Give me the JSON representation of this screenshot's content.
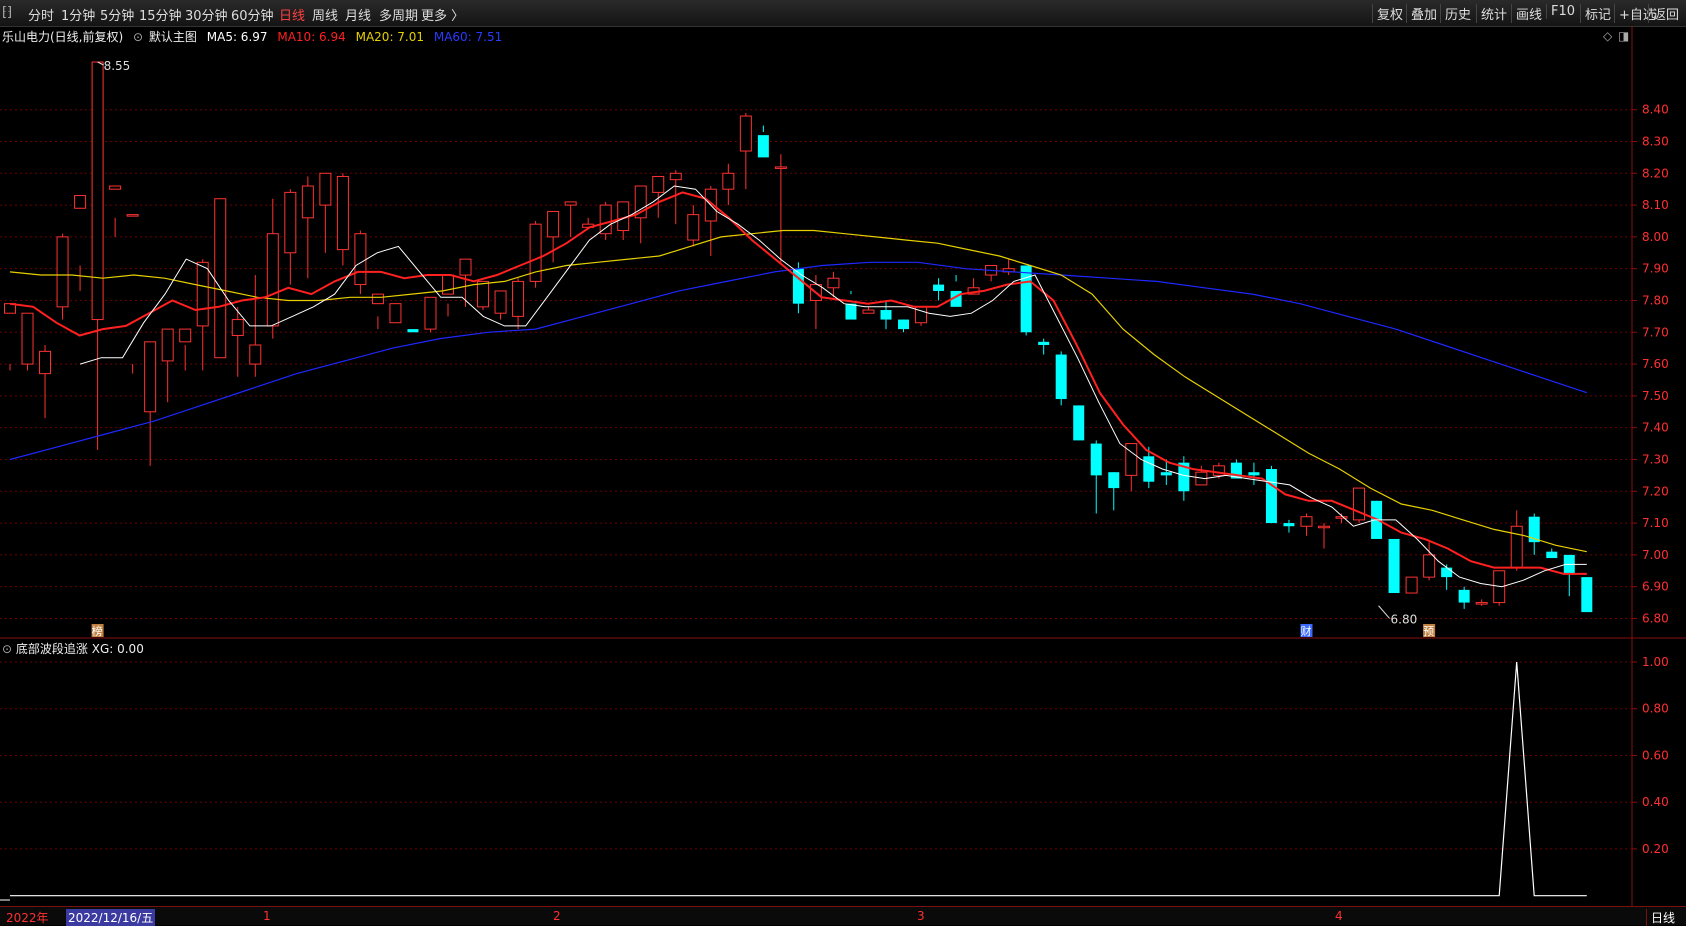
{
  "toolbar": {
    "left_icon": "⁅⁆",
    "periods": [
      "分时",
      "1分钟",
      "5分钟",
      "15分钟",
      "30分钟",
      "60分钟",
      "日线",
      "周线",
      "月线",
      "多周期",
      "更多 〉"
    ],
    "active_period": "日线",
    "right_buttons": [
      "复权",
      "叠加",
      "历史",
      "统计",
      "画线",
      "F10",
      "标记",
      "+自选",
      "返回"
    ]
  },
  "legend": {
    "stock": "乐山电力(日线,前复权)",
    "template": "默认主图",
    "ma5": "MA5: 6.97",
    "ma10": "MA10: 6.94",
    "ma20": "MA20: 7.01",
    "ma60": "MA60: 7.51"
  },
  "indicator_legend": {
    "name": "底部波段追涨",
    "value": "XG: 0.00"
  },
  "bottom": {
    "year": "2022年",
    "cursor_date": "2022/12/16/五",
    "month_labels": [
      "1",
      "2",
      "3",
      "4"
    ],
    "period_tab": "日线"
  },
  "colors": {
    "up": "#ff3232",
    "down": "#00ffff",
    "ma5": "#ffffff",
    "ma10": "#ff2020",
    "ma20": "#e6d000",
    "ma60": "#1e28ff",
    "grid": "#6a0000",
    "axis_text": "#ff3030"
  },
  "chart_data": [
    {
      "type": "candlestick",
      "title": "乐山电力(日线,前复权)",
      "y_ticks": [
        "8.40",
        "8.30",
        "8.20",
        "8.10",
        "8.00",
        "7.90",
        "7.80",
        "7.70",
        "7.60",
        "7.50",
        "7.40",
        "7.30",
        "7.20",
        "7.10",
        "7.00",
        "6.90",
        "6.80"
      ],
      "ylim": [
        6.77,
        8.55
      ],
      "annotations": {
        "high": "8.55",
        "low": "6.80"
      },
      "event_markers": [
        "榜",
        "财",
        "预"
      ],
      "ohlc": [
        [
          7.76,
          7.79,
          7.58,
          7.6
        ],
        [
          7.6,
          7.76,
          7.58,
          7.75
        ],
        [
          7.57,
          7.64,
          7.43,
          7.66
        ],
        [
          7.78,
          8.0,
          7.74,
          8.01
        ],
        [
          8.09,
          8.13,
          7.83,
          7.91
        ],
        [
          7.74,
          8.55,
          7.33,
          8.15
        ],
        [
          8.15,
          8.16,
          8.0,
          8.06
        ],
        [
          8.07,
          8.07,
          7.57,
          7.6
        ],
        [
          7.45,
          7.67,
          7.28,
          7.67
        ],
        [
          7.61,
          7.71,
          7.48,
          7.71
        ],
        [
          7.67,
          7.71,
          7.58,
          7.66
        ],
        [
          7.72,
          7.92,
          7.58,
          7.93
        ],
        [
          7.62,
          8.12,
          7.62,
          7.89
        ],
        [
          7.69,
          7.74,
          7.56,
          7.78
        ],
        [
          7.6,
          7.66,
          7.56,
          7.88
        ],
        [
          7.72,
          8.01,
          7.68,
          8.12
        ],
        [
          7.95,
          8.14,
          7.85,
          8.15
        ],
        [
          8.06,
          8.16,
          7.87,
          8.19
        ],
        [
          8.1,
          8.2,
          7.95,
          8.13
        ],
        [
          7.96,
          8.19,
          7.91,
          8.2
        ],
        [
          7.85,
          8.01,
          7.82,
          8.02
        ],
        [
          7.79,
          7.82,
          7.71,
          7.75
        ],
        [
          7.73,
          7.79,
          7.73,
          7.73
        ],
        [
          7.71,
          7.7,
          7.65,
          7.65
        ],
        [
          7.71,
          7.81,
          7.7,
          7.8
        ],
        [
          7.82,
          7.88,
          7.75,
          7.79
        ],
        [
          7.88,
          7.93,
          7.78,
          7.89
        ],
        [
          7.78,
          7.86,
          7.77,
          7.86
        ],
        [
          7.76,
          7.83,
          7.74,
          7.8
        ],
        [
          7.75,
          7.86,
          7.71,
          7.87
        ],
        [
          7.86,
          8.04,
          7.84,
          8.05
        ],
        [
          8.0,
          8.08,
          7.92,
          8.08
        ],
        [
          8.1,
          8.11,
          8.0,
          8.1
        ],
        [
          8.03,
          8.04,
          8.03,
          8.06
        ],
        [
          8.01,
          8.1,
          7.99,
          8.11
        ],
        [
          8.02,
          8.11,
          7.99,
          8.05
        ],
        [
          8.06,
          8.16,
          7.98,
          8.15
        ],
        [
          8.14,
          8.19,
          8.06,
          8.15
        ],
        [
          8.18,
          8.2,
          8.04,
          8.21
        ],
        [
          7.99,
          8.07,
          7.97,
          8.1
        ],
        [
          8.05,
          8.15,
          7.94,
          8.16
        ],
        [
          8.15,
          8.2,
          8.1,
          8.23
        ],
        [
          8.27,
          8.38,
          8.15,
          8.39
        ],
        [
          8.32,
          8.25,
          8.33,
          8.35
        ],
        [
          8.22,
          8.22,
          7.92,
          8.26
        ],
        [
          7.9,
          7.79,
          7.76,
          7.92
        ],
        [
          7.8,
          7.85,
          7.71,
          7.88
        ],
        [
          7.84,
          7.87,
          7.81,
          7.89
        ],
        [
          7.79,
          7.74,
          7.83,
          7.82
        ],
        [
          7.76,
          7.77,
          7.76,
          7.78
        ],
        [
          7.77,
          7.74,
          7.71,
          7.8
        ],
        [
          7.74,
          7.71,
          7.7,
          7.74
        ],
        [
          7.73,
          7.78,
          7.72,
          7.78
        ],
        [
          7.85,
          7.83,
          7.8,
          7.87
        ],
        [
          7.83,
          7.78,
          7.86,
          7.88
        ],
        [
          7.82,
          7.84,
          7.83,
          7.87
        ],
        [
          7.88,
          7.91,
          7.86,
          7.88
        ],
        [
          7.89,
          7.9,
          7.93,
          7.88
        ],
        [
          7.91,
          7.7,
          7.69,
          7.91
        ],
        [
          7.67,
          7.66,
          7.63,
          7.68
        ],
        [
          7.63,
          7.49,
          7.47,
          7.64
        ],
        [
          7.47,
          7.36,
          7.37,
          7.47
        ],
        [
          7.35,
          7.25,
          7.13,
          7.36
        ],
        [
          7.26,
          7.21,
          7.14,
          7.26
        ],
        [
          7.25,
          7.35,
          7.2,
          7.35
        ],
        [
          7.31,
          7.23,
          7.21,
          7.34
        ],
        [
          7.26,
          7.25,
          7.22,
          7.3
        ],
        [
          7.29,
          7.2,
          7.17,
          7.31
        ],
        [
          7.22,
          7.26,
          7.24,
          7.28
        ],
        [
          7.25,
          7.28,
          7.24,
          7.29
        ],
        [
          7.29,
          7.24,
          7.25,
          7.3
        ],
        [
          7.26,
          7.25,
          7.22,
          7.29
        ],
        [
          7.27,
          7.1,
          7.1,
          7.28
        ],
        [
          7.1,
          7.09,
          7.07,
          7.11
        ],
        [
          7.09,
          7.12,
          7.06,
          7.13
        ],
        [
          7.09,
          7.09,
          7.02,
          7.1
        ],
        [
          7.12,
          7.12,
          7.1,
          7.13
        ],
        [
          7.11,
          7.21,
          7.1,
          7.21
        ],
        [
          7.17,
          7.05,
          7.05,
          7.17
        ],
        [
          7.05,
          6.88,
          6.88,
          7.05
        ],
        [
          6.88,
          6.93,
          6.9,
          6.93
        ],
        [
          6.93,
          7.0,
          6.92,
          7.04
        ],
        [
          6.96,
          6.93,
          6.89,
          6.97
        ],
        [
          6.89,
          6.85,
          6.83,
          6.9
        ],
        [
          6.85,
          6.85,
          6.84,
          6.86
        ],
        [
          6.85,
          6.95,
          6.84,
          6.95
        ],
        [
          6.96,
          7.09,
          6.95,
          7.14
        ],
        [
          7.12,
          7.04,
          7.0,
          7.13
        ],
        [
          7.01,
          6.99,
          7.0,
          7.02
        ],
        [
          7.0,
          6.94,
          6.87,
          7.0
        ],
        [
          6.93,
          6.82,
          6.82,
          6.93
        ]
      ],
      "ma5": [
        7.6,
        7.62,
        7.62,
        7.73,
        7.82,
        7.93,
        7.9,
        7.8,
        7.72,
        7.72,
        7.75,
        7.78,
        7.82,
        7.91,
        7.95,
        7.97,
        7.89,
        7.81,
        7.81,
        7.75,
        7.72,
        7.72,
        7.81,
        7.9,
        7.99,
        8.04,
        8.07,
        8.11,
        8.16,
        8.15,
        8.08,
        8.04,
        7.99,
        7.93,
        7.88,
        7.84,
        7.79,
        7.78,
        7.78,
        7.78,
        7.76,
        7.75,
        7.76,
        7.8,
        7.86,
        7.88,
        7.75,
        7.62,
        7.48,
        7.35,
        7.3,
        7.27,
        7.25,
        7.24,
        7.25,
        7.24,
        7.23,
        7.22,
        7.18,
        7.15,
        7.09,
        7.11,
        7.11,
        7.05,
        6.98,
        6.93,
        6.91,
        6.9,
        6.92,
        6.95,
        6.97,
        6.97
      ],
      "ma5_start": 4,
      "ma10": [
        7.79,
        7.78,
        7.73,
        7.69,
        7.71,
        7.72,
        7.76,
        7.8,
        7.77,
        7.78,
        7.8,
        7.81,
        7.84,
        7.82,
        7.86,
        7.89,
        7.89,
        7.87,
        7.88,
        7.88,
        7.86,
        7.88,
        7.91,
        7.94,
        7.98,
        8.03,
        8.05,
        8.07,
        8.11,
        8.14,
        8.12,
        8.06,
        7.99,
        7.93,
        7.87,
        7.81,
        7.8,
        7.79,
        7.8,
        7.78,
        7.78,
        7.82,
        7.83,
        7.85,
        7.86,
        7.8,
        7.66,
        7.51,
        7.41,
        7.33,
        7.29,
        7.27,
        7.26,
        7.25,
        7.24,
        7.19,
        7.17,
        7.17,
        7.14,
        7.11,
        7.07,
        7.05,
        7.02,
        6.98,
        6.96,
        6.96,
        6.96,
        6.94,
        6.94
      ],
      "ma10_start": 0,
      "ma20": [
        7.89,
        7.88,
        7.88,
        7.87,
        7.88,
        7.87,
        7.85,
        7.83,
        7.81,
        7.8,
        7.8,
        7.81,
        7.81,
        7.82,
        7.83,
        7.85,
        7.86,
        7.89,
        7.91,
        7.92,
        7.93,
        7.94,
        7.97,
        8.0,
        8.01,
        8.02,
        8.02,
        8.01,
        8.0,
        7.99,
        7.98,
        7.96,
        7.94,
        7.91,
        7.88,
        7.82,
        7.71,
        7.63,
        7.56,
        7.5,
        7.44,
        7.38,
        7.32,
        7.27,
        7.21,
        7.16,
        7.14,
        7.11,
        7.08,
        7.06,
        7.03,
        7.01
      ],
      "ma20_start": 0,
      "ma60": [
        7.3,
        7.34,
        7.38,
        7.42,
        7.47,
        7.52,
        7.57,
        7.61,
        7.65,
        7.68,
        7.7,
        7.71,
        7.75,
        7.79,
        7.83,
        7.86,
        7.89,
        7.91,
        7.92,
        7.92,
        7.9,
        7.89,
        7.88,
        7.87,
        7.86,
        7.84,
        7.82,
        7.79,
        7.75,
        7.71,
        7.66,
        7.61,
        7.56,
        7.51
      ],
      "ma60_start": 0
    },
    {
      "type": "line",
      "title": "底部波段追涨",
      "y_ticks": [
        "1.00",
        "0.80",
        "0.60",
        "0.40",
        "0.20"
      ],
      "ylim": [
        -0.01,
        1.0
      ],
      "series": [
        {
          "name": "XG",
          "values": [
            0,
            0,
            0,
            0,
            0,
            0,
            0,
            0,
            0,
            0,
            0,
            0,
            0,
            0,
            0,
            0,
            0,
            0,
            0,
            0,
            0,
            0,
            0,
            0,
            0,
            0,
            0,
            0,
            0,
            0,
            0,
            0,
            0,
            0,
            0,
            0,
            0,
            0,
            0,
            0,
            0,
            0,
            0,
            0,
            0,
            0,
            0,
            0,
            0,
            0,
            0,
            0,
            0,
            0,
            0,
            0,
            0,
            0,
            0,
            0,
            0,
            0,
            0,
            0,
            0,
            0,
            0,
            0,
            0,
            0,
            0,
            0,
            0,
            0,
            0,
            0,
            0,
            0,
            0,
            0,
            0,
            0,
            0,
            0,
            0,
            0,
            1,
            0,
            0,
            0,
            0
          ]
        }
      ]
    }
  ]
}
